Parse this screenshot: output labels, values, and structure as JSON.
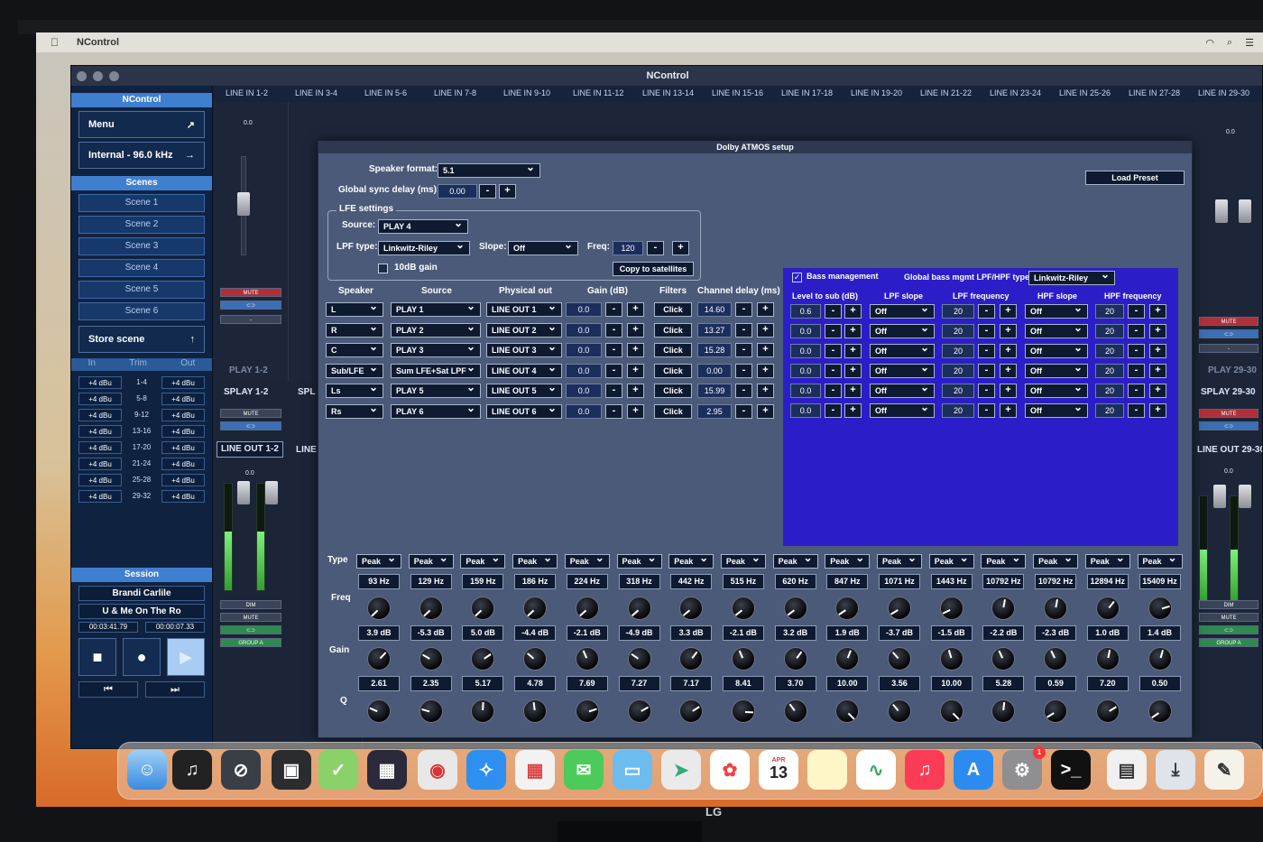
{
  "menubar": {
    "app_name": "NControl"
  },
  "window": {
    "title": "NControl"
  },
  "sidebar": {
    "title": "NControl",
    "menu_label": "Menu",
    "sample_rate": "Internal - 96.0 kHz",
    "scenes_header": "Scenes",
    "scenes": [
      "Scene 1",
      "Scene 2",
      "Scene 3",
      "Scene 4",
      "Scene 5",
      "Scene 6"
    ],
    "store_scene": "Store scene",
    "io_headers": {
      "in": "In",
      "trim": "Trim",
      "out": "Out"
    },
    "io_rows": [
      {
        "in": "+4 dBu",
        "trim": "1-4",
        "out": "+4 dBu"
      },
      {
        "in": "+4 dBu",
        "trim": "5-8",
        "out": "+4 dBu"
      },
      {
        "in": "+4 dBu",
        "trim": "9-12",
        "out": "+4 dBu"
      },
      {
        "in": "+4 dBu",
        "trim": "13-16",
        "out": "+4 dBu"
      },
      {
        "in": "+4 dBu",
        "trim": "17-20",
        "out": "+4 dBu"
      },
      {
        "in": "+4 dBu",
        "trim": "21-24",
        "out": "+4 dBu"
      },
      {
        "in": "+4 dBu",
        "trim": "25-28",
        "out": "+4 dBu"
      },
      {
        "in": "+4 dBu",
        "trim": "29-32",
        "out": "+4 dBu"
      }
    ],
    "session_header": "Session",
    "session_artist": "Brandi Carlile",
    "session_song": "U & Me On The Ro",
    "time_total": "00:03:41.79",
    "time_pos": "00:00:07.33"
  },
  "tabs": [
    "LINE IN 1-2",
    "LINE IN 3-4",
    "LINE IN 5-6",
    "LINE IN 7-8",
    "LINE IN 9-10",
    "LINE IN 11-12",
    "LINE IN 13-14",
    "LINE IN 15-16",
    "LINE IN 17-18",
    "LINE IN 19-20",
    "LINE IN 21-22",
    "LINE IN 23-24",
    "LINE IN 25-26",
    "LINE IN 27-28",
    "LINE IN 29-30"
  ],
  "strips": {
    "left_level": "0.0",
    "mute": "MUTE",
    "play_left": "PLAY 1-2",
    "play_right": "PLAY 29-30",
    "splay_left": "SPLAY 1-2",
    "splay_mid": "SPL",
    "splay_right": "SPLAY 29-30",
    "lineout_left": "LINE OUT 1-2",
    "lineout_mid": "LINE",
    "lineout_right": "LINE OUT 29-30",
    "dim": "DIM",
    "group": "GROUP A",
    "dash": "-"
  },
  "dialog": {
    "title": "Dolby ATMOS setup",
    "speaker_format_label": "Speaker format:",
    "speaker_format": "5.1",
    "sync_delay_label": "Global sync delay (ms):",
    "sync_delay": "0.00",
    "load_preset": "Load Preset",
    "settings_label": "LFE settings",
    "source_label": "Source:",
    "source": "PLAY 4",
    "lpf_type_label": "LPF type:",
    "lpf_type": "Linkwitz-Riley",
    "slope_label": "Slope:",
    "slope": "Off",
    "freq_label": "Freq:",
    "freq": "120",
    "gain10_label": "10dB gain",
    "copy_sat": "Copy to satellites",
    "cols": {
      "speaker": "Speaker",
      "source": "Source",
      "phys": "Physical out",
      "gain": "Gain (dB)",
      "filters": "Filters",
      "delay": "Channel delay (ms)"
    },
    "rows": [
      {
        "speaker": "L",
        "source": "PLAY 1",
        "out": "LINE OUT 1",
        "gain": "0.0",
        "filter": "Click",
        "delay": "14.60"
      },
      {
        "speaker": "R",
        "source": "PLAY 2",
        "out": "LINE OUT 2",
        "gain": "0.0",
        "filter": "Click",
        "delay": "13.27"
      },
      {
        "speaker": "C",
        "source": "PLAY 3",
        "out": "LINE OUT 3",
        "gain": "0.0",
        "filter": "Click",
        "delay": "15.28"
      },
      {
        "speaker": "Sub/LFE",
        "source": "Sum LFE+Sat LPF",
        "out": "LINE OUT 4",
        "gain": "0.0",
        "filter": "Click",
        "delay": "0.00"
      },
      {
        "speaker": "Ls",
        "source": "PLAY 5",
        "out": "LINE OUT 5",
        "gain": "0.0",
        "filter": "Click",
        "delay": "15.99"
      },
      {
        "speaker": "Rs",
        "source": "PLAY 6",
        "out": "LINE OUT 6",
        "gain": "0.0",
        "filter": "Click",
        "delay": "2.95"
      }
    ],
    "bass": {
      "enabled_label": "Bass management",
      "global_label": "Global bass mgmt LPF/HPF type:",
      "global_type": "Linkwitz-Riley",
      "cols": {
        "level": "Level to sub (dB)",
        "lpf_slope": "LPF slope",
        "lpf_freq": "LPF frequency",
        "hpf_slope": "HPF slope",
        "hpf_freq": "HPF frequency"
      },
      "rows": [
        {
          "level": "0.6",
          "lpf_slope": "Off",
          "lpf_freq": "20",
          "hpf_slope": "Off",
          "hpf_freq": "20"
        },
        {
          "level": "0.0",
          "lpf_slope": "Off",
          "lpf_freq": "20",
          "hpf_slope": "Off",
          "hpf_freq": "20"
        },
        {
          "level": "0.0",
          "lpf_slope": "Off",
          "lpf_freq": "20",
          "hpf_slope": "Off",
          "hpf_freq": "20"
        },
        {
          "level": "0.0",
          "lpf_slope": "Off",
          "lpf_freq": "20",
          "hpf_slope": "Off",
          "hpf_freq": "20"
        },
        {
          "level": "0.0",
          "lpf_slope": "Off",
          "lpf_freq": "20",
          "hpf_slope": "Off",
          "hpf_freq": "20"
        },
        {
          "level": "0.0",
          "lpf_slope": "Off",
          "lpf_freq": "20",
          "hpf_slope": "Off",
          "hpf_freq": "20"
        }
      ]
    },
    "eq": {
      "type_label": "Type",
      "freq_label": "Freq",
      "gain_label": "Gain",
      "q_label": "Q",
      "type": "Peak",
      "freqs": [
        "93 Hz",
        "129 Hz",
        "159 Hz",
        "186 Hz",
        "224 Hz",
        "318 Hz",
        "442 Hz",
        "515 Hz",
        "620 Hz",
        "847 Hz",
        "1071 Hz",
        "1443 Hz",
        "10792 Hz",
        "10792 Hz",
        "12894 Hz",
        "15409 Hz"
      ],
      "gains": [
        "3.9 dB",
        "-5.3 dB",
        "5.0 dB",
        "-4.4 dB",
        "-2.1 dB",
        "-4.9 dB",
        "3.3 dB",
        "-2.1 dB",
        "3.2 dB",
        "1.9 dB",
        "-3.7 dB",
        "-1.5 dB",
        "-2.2 dB",
        "-2.3 dB",
        "1.0 dB",
        "1.4 dB"
      ],
      "qs": [
        "2.61",
        "2.35",
        "5.17",
        "4.78",
        "7.69",
        "7.27",
        "7.17",
        "8.41",
        "3.70",
        "10.00",
        "3.56",
        "10.00",
        "5.28",
        "0.59",
        "7.20",
        "0.50"
      ]
    }
  },
  "dock": {
    "calendar_month": "APR",
    "calendar_day": "13",
    "badge": "1"
  },
  "monitor_brand": "LG"
}
